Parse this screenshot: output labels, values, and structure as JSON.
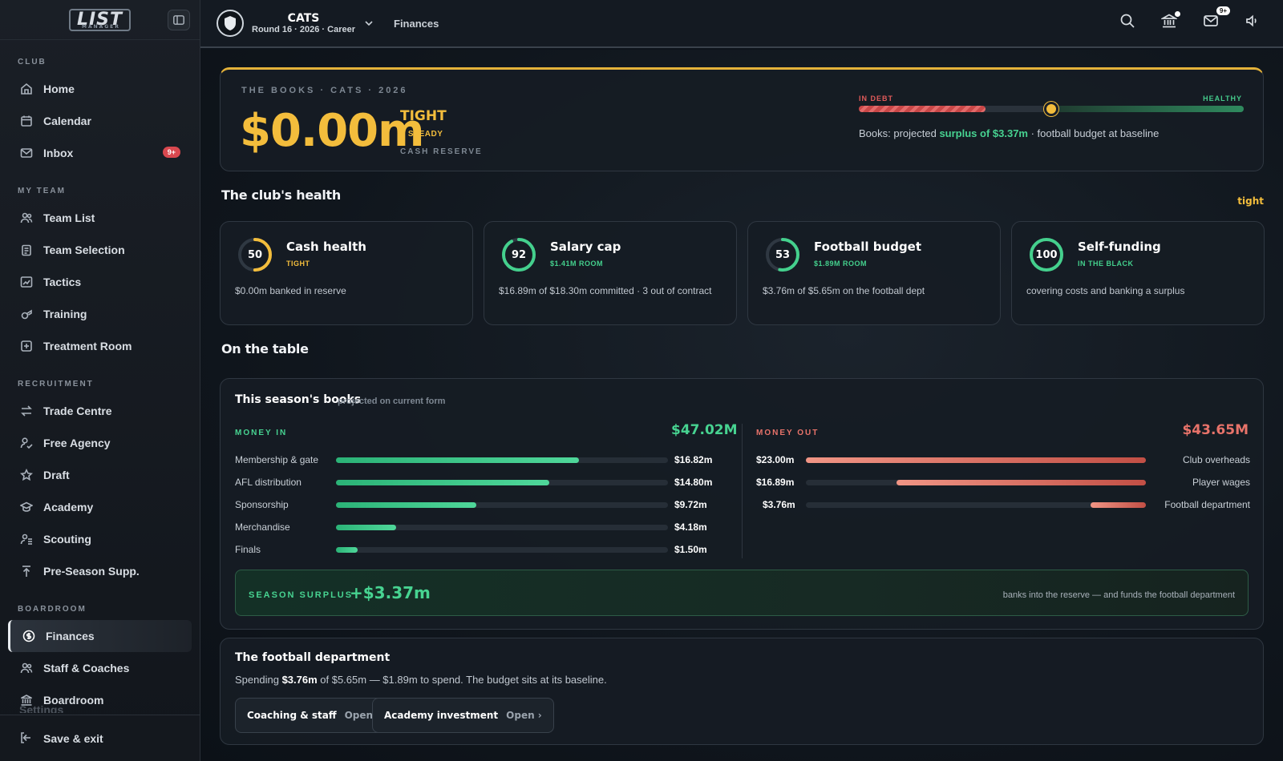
{
  "sidebar": {
    "logo": "LIST",
    "logo_small": "MANAGER",
    "sections": [
      {
        "title": "CLUB",
        "items": [
          {
            "label": "Home",
            "icon": "home-icon"
          },
          {
            "label": "Calendar",
            "icon": "calendar-icon"
          },
          {
            "label": "Inbox",
            "icon": "mail-icon",
            "badge": "9+"
          }
        ]
      },
      {
        "title": "MY TEAM",
        "items": [
          {
            "label": "Team List",
            "icon": "users-icon"
          },
          {
            "label": "Team Selection",
            "icon": "clipboard-icon"
          },
          {
            "label": "Tactics",
            "icon": "chart-icon"
          },
          {
            "label": "Training",
            "icon": "whistle-icon"
          },
          {
            "label": "Treatment Room",
            "icon": "medical-icon"
          }
        ]
      },
      {
        "title": "RECRUITMENT",
        "items": [
          {
            "label": "Trade Centre",
            "icon": "swap-icon"
          },
          {
            "label": "Free Agency",
            "icon": "user-check-icon"
          },
          {
            "label": "Draft",
            "icon": "star-icon"
          },
          {
            "label": "Academy",
            "icon": "graduation-icon"
          },
          {
            "label": "Scouting",
            "icon": "binoculars-icon"
          },
          {
            "label": "Pre-Season Supp.",
            "icon": "arrow-up-icon"
          }
        ]
      },
      {
        "title": "BOARDROOM",
        "items": [
          {
            "label": "Finances",
            "icon": "dollar-icon",
            "active": true
          },
          {
            "label": "Staff & Coaches",
            "icon": "users-icon"
          },
          {
            "label": "Boardroom",
            "icon": "bank-icon"
          }
        ]
      }
    ],
    "ghost": "Settings",
    "save_exit": "Save & exit"
  },
  "topbar": {
    "team": "CATS",
    "sub": "Round 16 · 2026 · Career",
    "page": "Finances",
    "mail_badge": "9+"
  },
  "hero": {
    "kicker": "THE BOOKS · CATS · 2026",
    "amount": "$0.00m",
    "status": "TIGHT",
    "steady": "● STEADY",
    "reserve_label": "CASH RESERVE",
    "meter_left": "IN DEBT",
    "meter_right": "HEALTHY",
    "meter_value": 0.5,
    "note_pre": "Books: projected ",
    "note_highlight": "surplus of $3.37m",
    "note_post": " · football budget at baseline"
  },
  "health": {
    "title": "The club's health",
    "tag": "tight",
    "cards": [
      {
        "value": 50,
        "title": "Cash health",
        "tag": "TIGHT",
        "color": "#f3bd3c",
        "desc": "$0.00m banked in reserve"
      },
      {
        "value": 92,
        "title": "Salary cap",
        "tag": "$1.41M ROOM",
        "color": "#44d08d",
        "desc": "$16.89m of $18.30m committed · 3 out of contract"
      },
      {
        "value": 53,
        "title": "Football budget",
        "tag": "$1.89M ROOM",
        "color": "#44d08d",
        "desc": "$3.76m of $5.65m on the football dept"
      },
      {
        "value": 100,
        "title": "Self-funding",
        "tag": "IN THE BLACK",
        "color": "#44d08d",
        "desc": "covering costs and banking a surplus"
      }
    ]
  },
  "table": {
    "title": "On the table",
    "books_title": "This season's books",
    "books_sub": "projected on current form",
    "money_in_label": "MONEY IN",
    "money_in_total": "$47.02M",
    "money_out_label": "MONEY OUT",
    "money_out_total": "$43.65M",
    "money_in": [
      {
        "label": "Membership & gate",
        "amount": "$16.82m",
        "value": 16.82
      },
      {
        "label": "AFL distribution",
        "amount": "$14.80m",
        "value": 14.8
      },
      {
        "label": "Sponsorship",
        "amount": "$9.72m",
        "value": 9.72
      },
      {
        "label": "Merchandise",
        "amount": "$4.18m",
        "value": 4.18
      },
      {
        "label": "Finals",
        "amount": "$1.50m",
        "value": 1.5
      }
    ],
    "money_out": [
      {
        "label": "Club overheads",
        "amount": "$23.00m",
        "value": 23.0
      },
      {
        "label": "Player wages",
        "amount": "$16.89m",
        "value": 16.89
      },
      {
        "label": "Football department",
        "amount": "$3.76m",
        "value": 3.76
      }
    ],
    "scale_max": 23.0,
    "surplus_label": "SEASON SURPLUS",
    "surplus_value": "+$3.37m",
    "surplus_note": "banks into the reserve — and funds the football department"
  },
  "dept": {
    "title": "The football department",
    "text_pre": "Spending ",
    "text_bold": "$3.76m",
    "text_post": " of $5.65m — $1.89m to spend. The budget sits at its baseline.",
    "buttons": [
      {
        "label": "Coaching & staff",
        "action": "Open ›"
      },
      {
        "label": "Academy investment",
        "action": "Open ›"
      }
    ]
  }
}
